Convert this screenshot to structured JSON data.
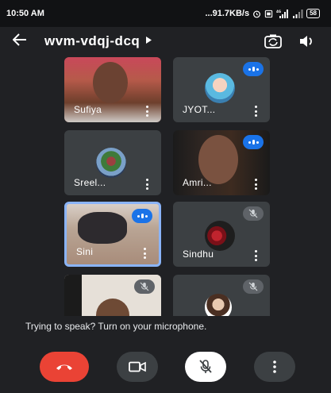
{
  "status_bar": {
    "time": "10:50 AM",
    "net_speed": "...91.7KB/s",
    "battery": "58",
    "icons": [
      "alarm-icon",
      "sim-icon",
      "signal-4g-icon",
      "signal-icon",
      "battery-icon"
    ]
  },
  "top_bar": {
    "meeting_code": "wvm-vdqj-dcq",
    "icons": [
      "back-arrow-icon",
      "caret-right-icon",
      "switch-camera-icon",
      "speaker-icon"
    ]
  },
  "participants": [
    {
      "name": "Sufiya",
      "state": "video"
    },
    {
      "name": "JYOT...",
      "state": "speaking"
    },
    {
      "name": "Sreel...",
      "state": "avatar"
    },
    {
      "name": "Amri...",
      "state": "speaking"
    },
    {
      "name": "Sini",
      "state": "speaking-active"
    },
    {
      "name": "Sindhu",
      "state": "muted"
    },
    {
      "name": "",
      "state": "muted"
    },
    {
      "name": "",
      "state": "muted"
    }
  ],
  "notice": "Trying to speak? Turn on your microphone.",
  "controls": {
    "icons": [
      "end-call-icon",
      "camera-icon",
      "mic-off-icon",
      "more-options-icon"
    ]
  },
  "colors": {
    "background": "#202124",
    "tile": "#3c4043",
    "end_call": "#ea4335",
    "speaking_blue": "#1a73e8",
    "active_border": "#8ab4f8"
  }
}
